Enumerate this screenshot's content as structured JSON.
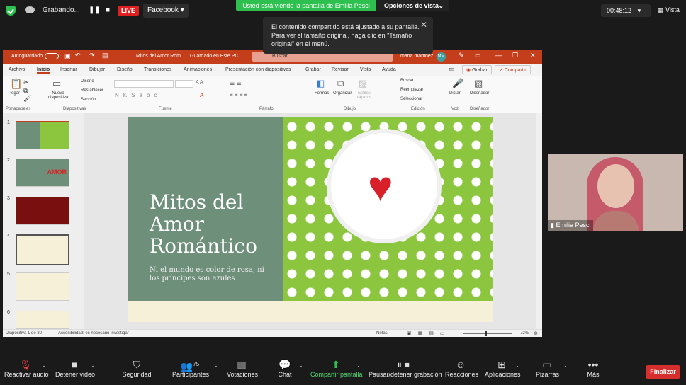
{
  "top": {
    "recording": "Grabando...",
    "live": "LIVE",
    "facebook": "Facebook",
    "viewing": "Usted está viendo la pantalla de Emilia Pesci",
    "view_options": "Opciones de vista",
    "timer": "00:48:12",
    "vista": "Vista",
    "tooltip": "El contenido compartido está ajustado a su pantalla. Para ver el tamaño original, haga clic en \"Tamaño original\" en el menú."
  },
  "ppt": {
    "autosave": "Autoguardado",
    "doc_title": "Mitos del Amor Rom...",
    "saved": "Guardado en Este PC",
    "search": "Buscar",
    "user": "maria martinez",
    "user_initials": "MM",
    "menu": [
      "Archivo",
      "Inicio",
      "Insertar",
      "Dibujar",
      "Diseño",
      "Transiciones",
      "Animaciones",
      "Presentación con diapositivas",
      "Grabar",
      "Revisar",
      "Vista",
      "Ayuda"
    ],
    "grabar_btn": "Grabar",
    "compartir_btn": "Compartir",
    "ribbon": {
      "pegar": "Pegar",
      "nueva": "Nueva diapositiva",
      "diseno": "Diseño",
      "restablecer": "Restablecer",
      "seccion": "Sección",
      "formas": "Formas",
      "organizar": "Organizar",
      "estilos": "Estilos rápidos",
      "buscar": "Buscar",
      "reemplazar": "Reemplazar",
      "seleccionar": "Seleccionar",
      "dictar": "Dictar",
      "disenador": "Diseñador"
    },
    "groups": [
      "Portapapeles",
      "Diapositivas",
      "Fuente",
      "Párrafo",
      "Dibujo",
      "Edición",
      "Voz",
      "Diseñador"
    ],
    "thumbs": [
      "1",
      "2",
      "3",
      "4",
      "5",
      "6"
    ],
    "thumb2_label": "AMOR",
    "slide_title": "Mitos del Amor Romántico",
    "slide_subtitle": "Ni el mundo es color de rosa, ni los príncipes son azules",
    "status_slide": "Diapositiva 1 de 30",
    "status_access": "Accesibilidad: es necesario investigar",
    "status_notes": "Notas",
    "zoom": "72%"
  },
  "camera": {
    "name": "Emilia Pesci"
  },
  "bottom": {
    "mute": "Reactivar audio",
    "video": "Detener video",
    "security": "Seguridad",
    "participants": "Participantes",
    "participants_count": "75",
    "polls": "Votaciones",
    "chat": "Chat",
    "share": "Compartir pantalla",
    "pause_rec": "Pausar/detener grabación",
    "reactions": "Reacciones",
    "apps": "Aplicaciones",
    "whiteboards": "Pizarras",
    "more": "Más",
    "end": "Finalizar"
  },
  "colors": {
    "share_green": "#2ec04f",
    "ppt_red": "#c43e1c",
    "end_red": "#d62d2d",
    "live_red": "#e02020"
  }
}
